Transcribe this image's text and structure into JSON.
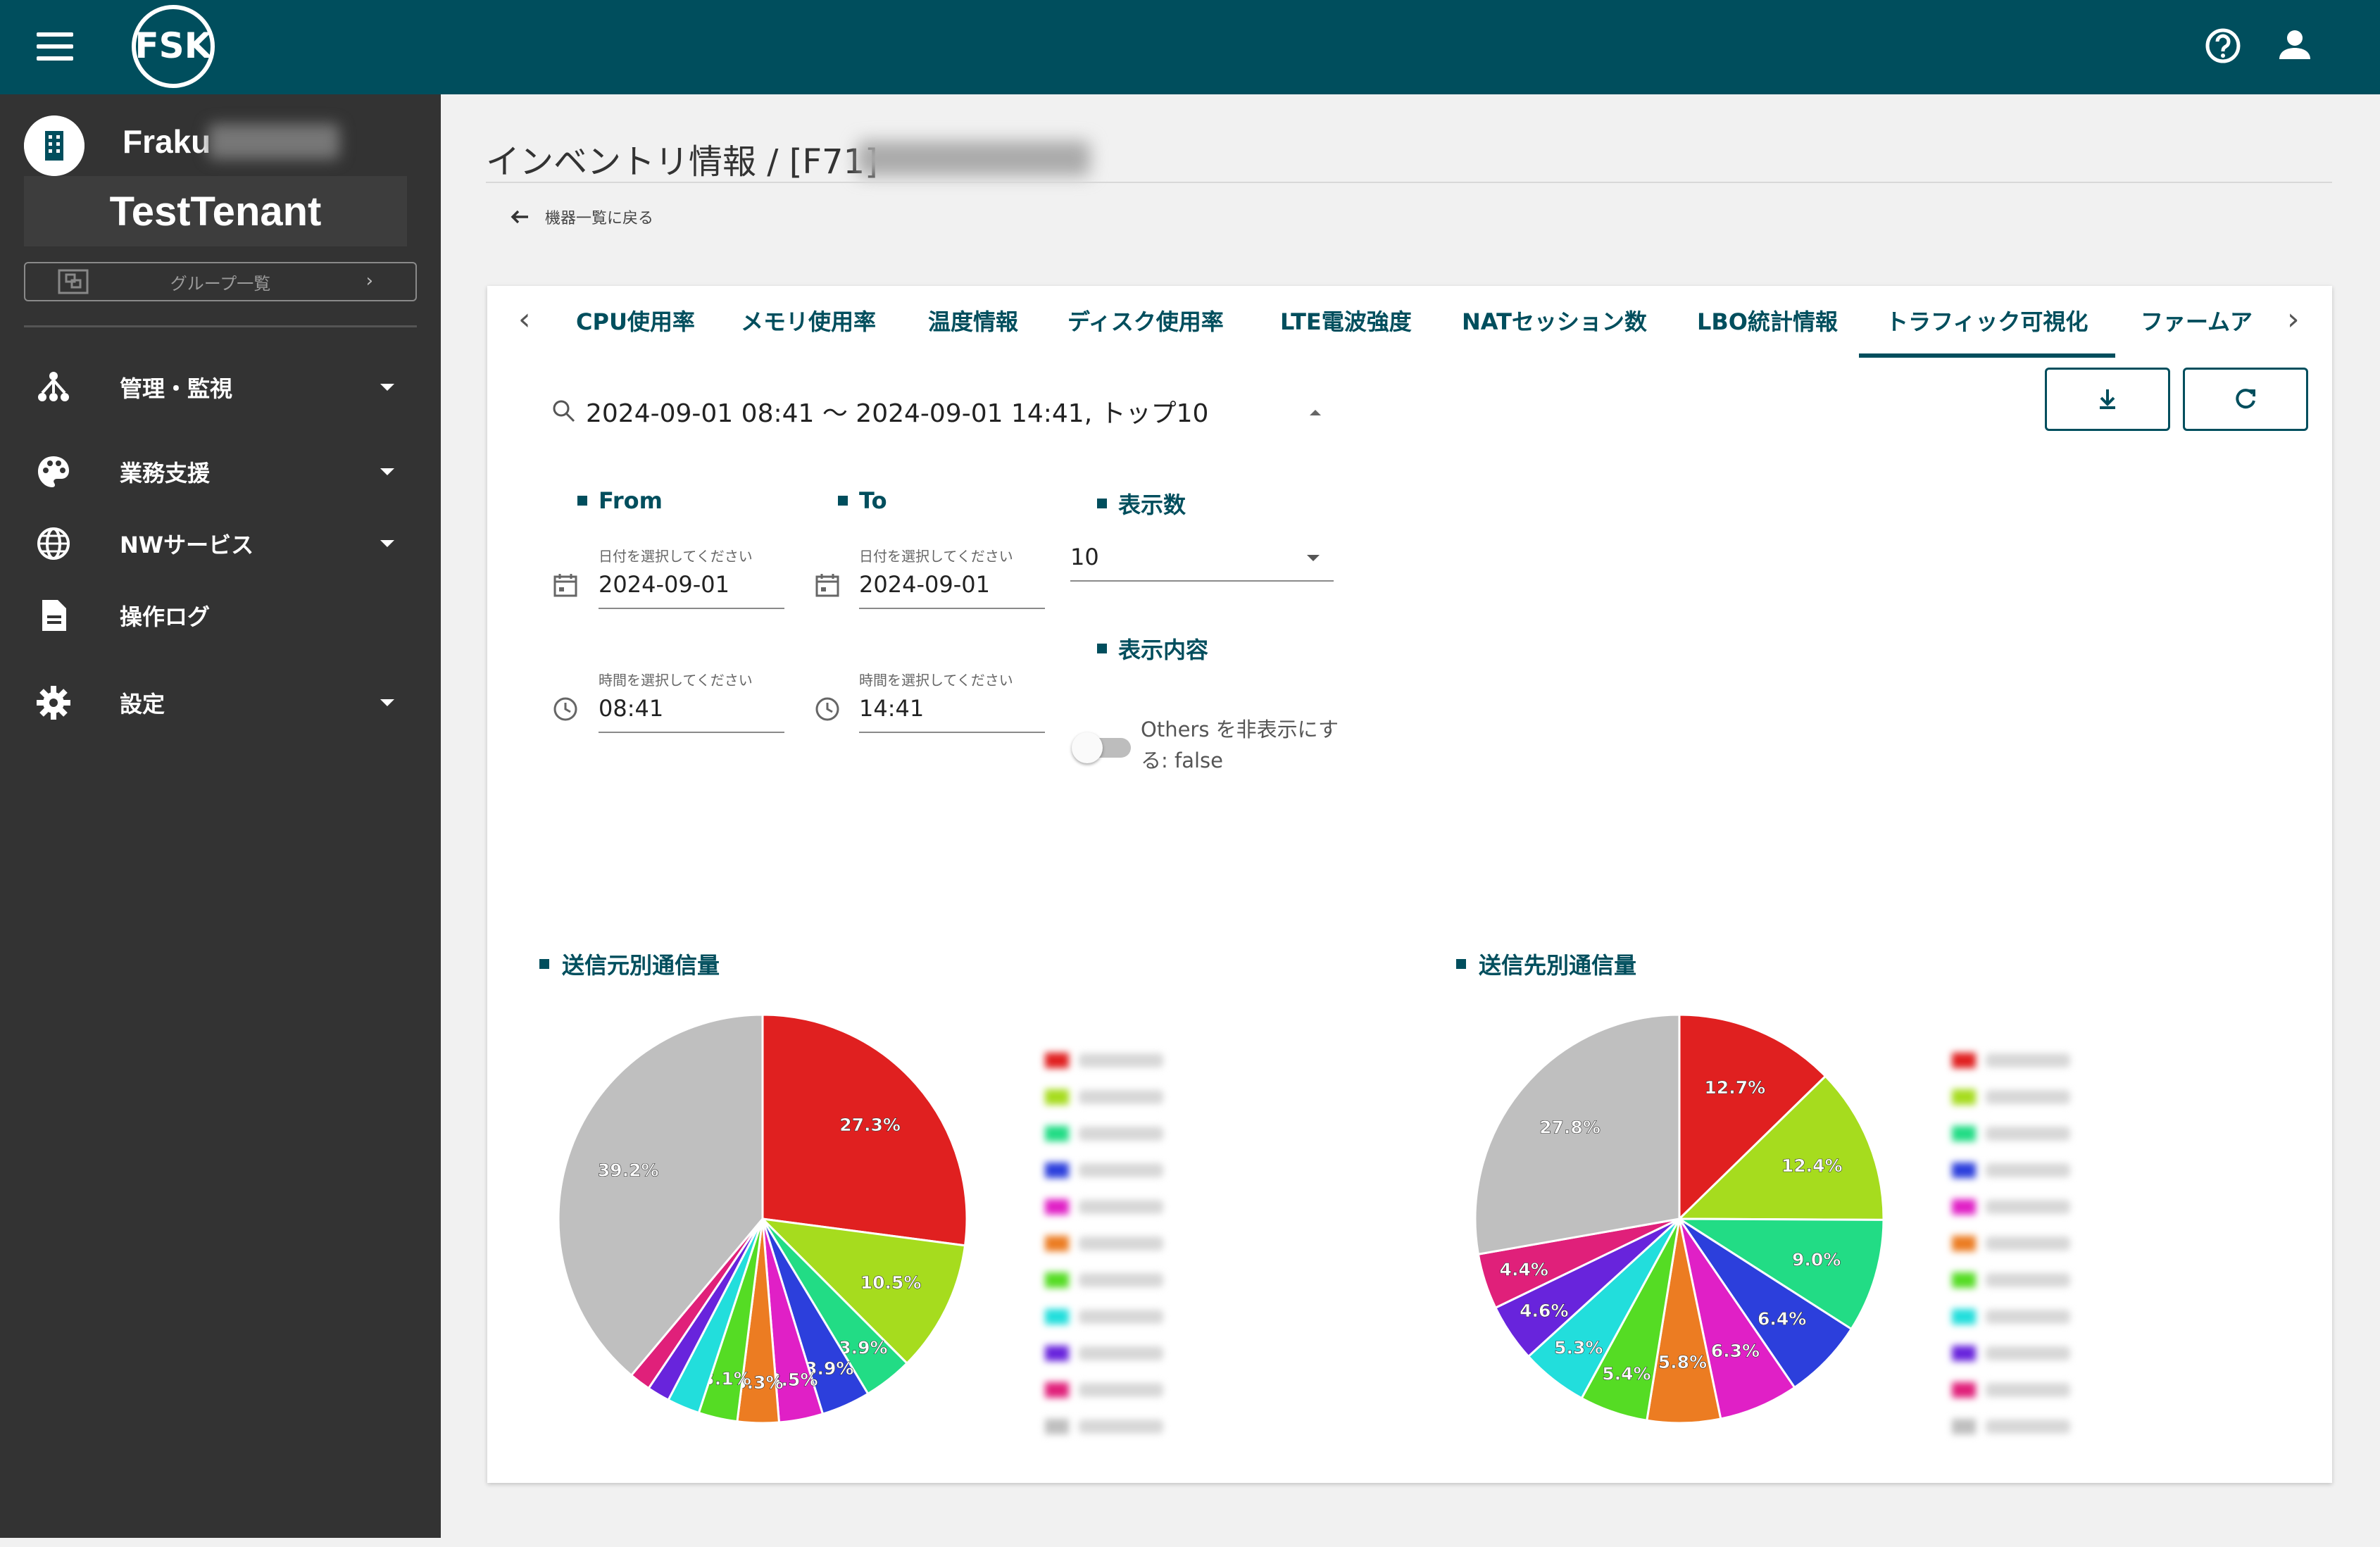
{
  "app": {
    "logo_text": "FSK"
  },
  "sidebar": {
    "org_name": "Fraku",
    "tenant": "TestTenant",
    "group_button": "グループ一覧",
    "items": [
      {
        "label": "管理・監視",
        "icon": "network-tree-icon",
        "expandable": true
      },
      {
        "label": "業務支援",
        "icon": "palette-icon",
        "expandable": true
      },
      {
        "label": "NWサービス",
        "icon": "globe-icon",
        "expandable": true
      },
      {
        "label": "操作ログ",
        "icon": "document-icon",
        "expandable": false
      },
      {
        "label": "設定",
        "icon": "gear-icon",
        "expandable": true
      }
    ]
  },
  "main": {
    "title": "インベントリ情報 / [F71]",
    "back_label": "機器一覧に戻る",
    "tabs": [
      {
        "label": "CPU使用率"
      },
      {
        "label": "メモリ使用率"
      },
      {
        "label": "温度情報"
      },
      {
        "label": "ディスク使用率"
      },
      {
        "label": "LTE電波強度"
      },
      {
        "label": "NATセッション数"
      },
      {
        "label": "LBO統計情報"
      },
      {
        "label": "トラフィック可視化",
        "active": true
      },
      {
        "label": "ファームア"
      }
    ],
    "summary": "2024-09-01 08:41 〜 2024-09-01 14:41, トップ10",
    "filters": {
      "from_label": "From",
      "to_label": "To",
      "count_label": "表示数",
      "content_label": "表示内容",
      "date_hint": "日付を選択してください",
      "time_hint": "時間を選択してください",
      "from_date": "2024-09-01",
      "from_time": "08:41",
      "to_date": "2024-09-01",
      "to_time": "14:41",
      "count": "10",
      "others_toggle": "Others を非表示にする: false"
    }
  },
  "chart_data": [
    {
      "type": "pie",
      "title": "送信元別通信量",
      "slices": [
        {
          "value": 27.3,
          "label": "27.3%",
          "color": "#e02020"
        },
        {
          "value": 10.5,
          "label": "10.5%",
          "color": "#a6dc1e"
        },
        {
          "value": 3.9,
          "label": "3.9%",
          "color": "#22dc85"
        },
        {
          "value": 3.9,
          "label": "3.9%",
          "color": "#2c3fdc"
        },
        {
          "value": 3.5,
          "label": "3.5%",
          "color": "#e020c6"
        },
        {
          "value": 3.3,
          "label": "3.3%",
          "color": "#ec7c22"
        },
        {
          "value": 3.1,
          "label": "3.1%",
          "color": "#55dc24"
        },
        {
          "value": 2.6,
          "label": "",
          "color": "#22dedc"
        },
        {
          "value": 1.8,
          "label": "",
          "color": "#6824dc"
        },
        {
          "value": 1.7,
          "label": "",
          "color": "#e0207a"
        },
        {
          "value": 39.2,
          "label": "39.2%",
          "color": "#bfbfbf"
        }
      ]
    },
    {
      "type": "pie",
      "title": "送信先別通信量",
      "slices": [
        {
          "value": 12.7,
          "label": "12.7%",
          "color": "#e02020"
        },
        {
          "value": 12.4,
          "label": "12.4%",
          "color": "#a6dc1e"
        },
        {
          "value": 9.0,
          "label": "9.0%",
          "color": "#22dc85"
        },
        {
          "value": 6.4,
          "label": "6.4%",
          "color": "#2c3fdc"
        },
        {
          "value": 6.3,
          "label": "6.3%",
          "color": "#e020c6"
        },
        {
          "value": 5.8,
          "label": "5.8%",
          "color": "#ec7c22"
        },
        {
          "value": 5.4,
          "label": "5.4%",
          "color": "#55dc24"
        },
        {
          "value": 5.3,
          "label": "5.3%",
          "color": "#22dedc"
        },
        {
          "value": 4.6,
          "label": "4.6%",
          "color": "#6824dc"
        },
        {
          "value": 4.4,
          "label": "4.4%",
          "color": "#e0207a"
        },
        {
          "value": 27.8,
          "label": "27.8%",
          "color": "#bfbfbf"
        }
      ]
    }
  ]
}
